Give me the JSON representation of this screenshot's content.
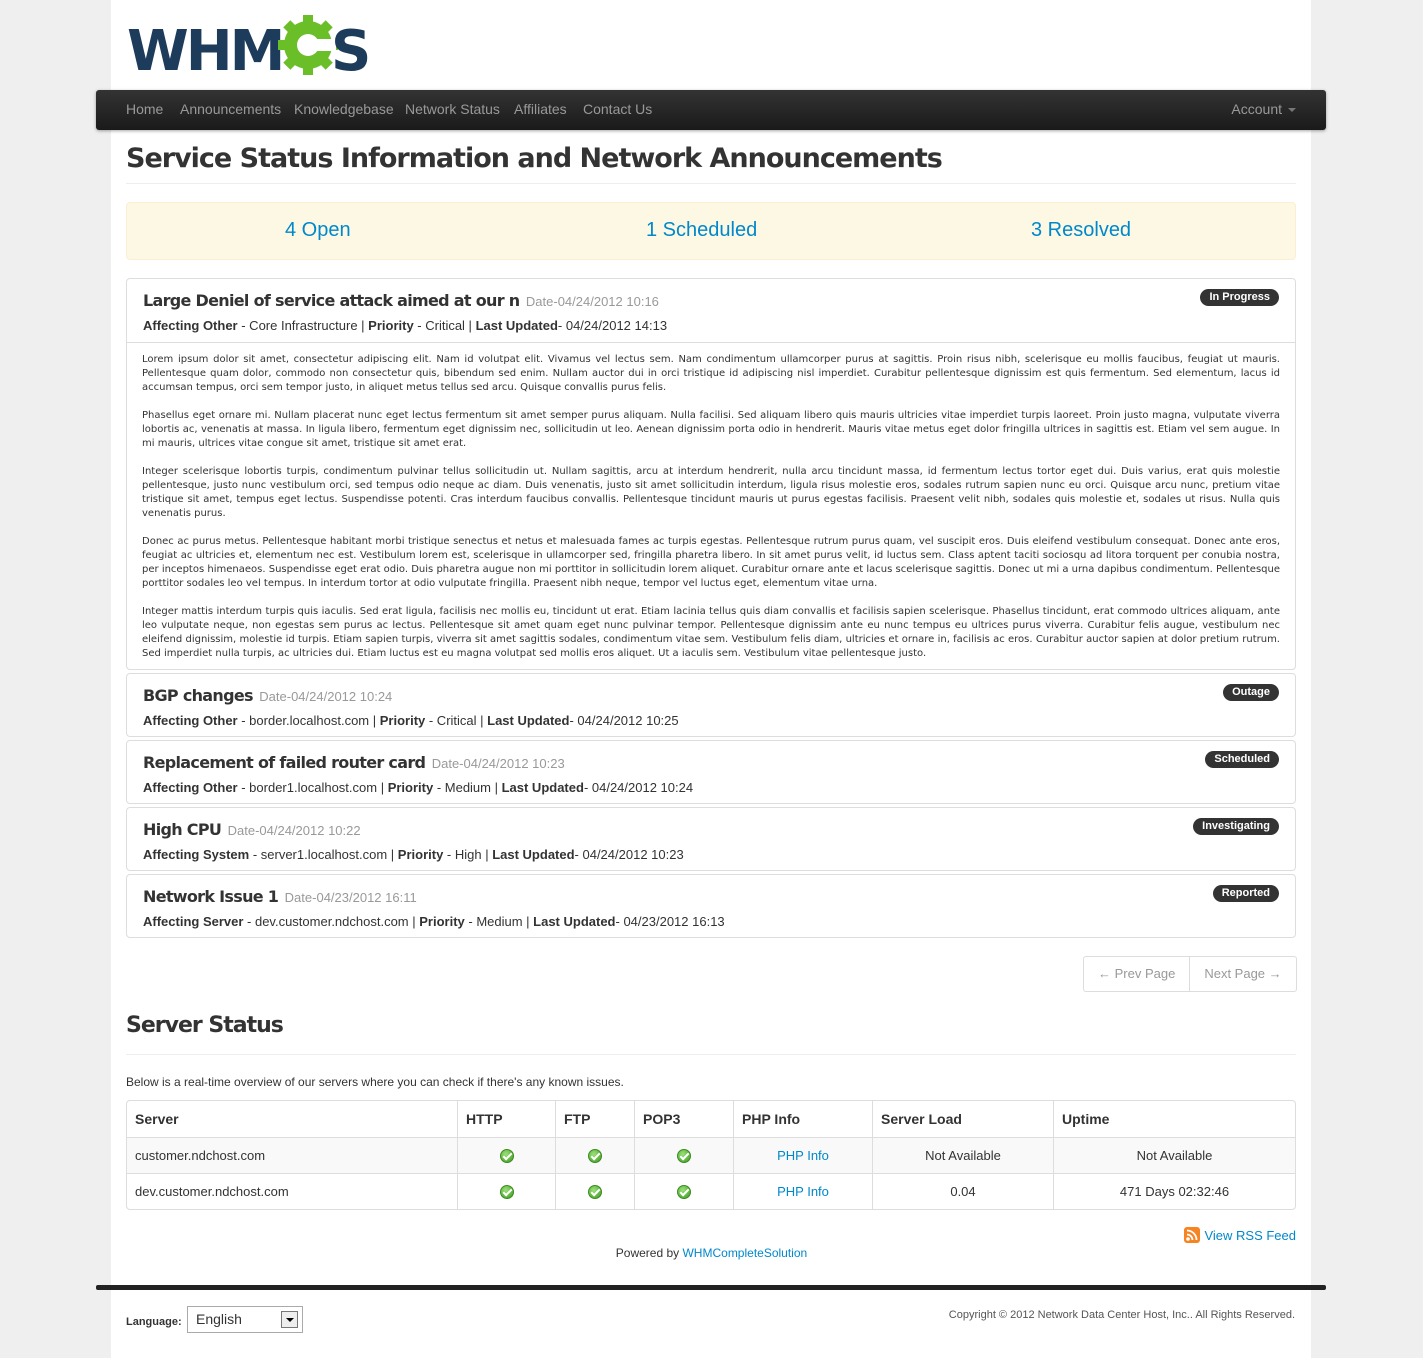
{
  "logo": {
    "text": "WHMCS",
    "accent": "#6abe28",
    "brand": "#1d3b5a"
  },
  "nav": {
    "items": [
      "Home",
      "Announcements",
      "Knowledgebase",
      "Network Status",
      "Affiliates",
      "Contact Us"
    ],
    "account": "Account"
  },
  "page_title": "Service Status Information and Network Announcements",
  "summary": {
    "open": "4 Open",
    "scheduled": "1 Scheduled",
    "resolved": "3 Resolved"
  },
  "issues": [
    {
      "title": "Large Deniel of service attack aimed at our n",
      "date": "Date-04/24/2012 10:16",
      "affecting_label": "Affecting Other",
      "affecting": " - Core Infrastructure | ",
      "priority_label": "Priority",
      "priority": " - Critical | ",
      "updated_label": "Last Updated",
      "updated": "- 04/24/2012 14:13",
      "status": "In Progress",
      "body": [
        "Lorem ipsum dolor sit amet, consectetur adipiscing elit. Nam id volutpat elit. Vivamus vel lectus sem. Nam condimentum ullamcorper purus at sagittis. Proin risus nibh, scelerisque eu mollis faucibus, feugiat ut mauris. Pellentesque quam dolor, commodo non consectetur quis, bibendum sed enim. Nullam auctor dui in orci tristique id adipiscing nisl imperdiet. Curabitur pellentesque dignissim est quis fermentum. Sed elementum, lacus id accumsan tempus, orci sem tempor justo, in aliquet metus tellus sed arcu. Quisque convallis purus felis.",
        "Phasellus eget ornare mi. Nullam placerat nunc eget lectus fermentum sit amet semper purus aliquam. Nulla facilisi. Sed aliquam libero quis mauris ultricies vitae imperdiet turpis laoreet. Proin justo magna, vulputate viverra lobortis ac, venenatis at massa. In ligula libero, fermentum eget dignissim nec, sollicitudin ut leo. Aenean dignissim porta odio in hendrerit. Mauris vitae metus eget dolor fringilla ultrices in sagittis est. Etiam vel sem augue. In mi mauris, ultrices vitae congue sit amet, tristique sit amet erat.",
        "Integer scelerisque lobortis turpis, condimentum pulvinar tellus sollicitudin ut. Nullam sagittis, arcu at interdum hendrerit, nulla arcu tincidunt massa, id fermentum lectus tortor eget dui. Duis varius, erat quis molestie pellentesque, justo nunc vestibulum orci, sed tempus odio neque ac diam. Duis venenatis, justo sit amet sollicitudin interdum, ligula risus molestie eros, sodales rutrum sapien nunc eu orci. Quisque arcu nunc, pretium vitae tristique sit amet, tempus eget lectus. Suspendisse potenti. Cras interdum faucibus convallis. Pellentesque tincidunt mauris ut purus egestas facilisis. Praesent velit nibh, sodales quis molestie et, sodales ut risus. Nulla quis venenatis purus.",
        "Donec ac purus metus. Pellentesque habitant morbi tristique senectus et netus et malesuada fames ac turpis egestas. Pellentesque rutrum purus quam, vel suscipit eros. Duis eleifend vestibulum consequat. Donec ante eros, feugiat ac ultricies et, elementum nec est. Vestibulum lorem est, scelerisque in ullamcorper sed, fringilla pharetra libero. In sit amet purus velit, id luctus sem. Class aptent taciti sociosqu ad litora torquent per conubia nostra, per inceptos himenaeos. Suspendisse eget erat odio. Duis pharetra augue non mi porttitor in sollicitudin lorem aliquet. Curabitur ornare ante et lacus scelerisque sagittis. Donec ut mi a urna dapibus condimentum. Pellentesque porttitor sodales leo vel tempus. In interdum tortor at odio vulputate fringilla. Praesent nibh neque, tempor vel luctus eget, elementum vitae urna.",
        "Integer mattis interdum turpis quis iaculis. Sed erat ligula, facilisis nec mollis eu, tincidunt ut erat. Etiam lacinia tellus quis diam convallis et facilisis sapien scelerisque. Phasellus tincidunt, erat commodo ultrices aliquam, ante leo vulputate neque, non egestas sem purus ac lectus. Pellentesque sit amet quam eget nunc pulvinar tempor. Pellentesque dignissim ante eu nunc tempus eu ultrices purus viverra. Curabitur felis augue, vestibulum nec eleifend dignissim, molestie id turpis. Etiam sapien turpis, viverra sit amet sagittis sodales, condimentum vitae sem. Vestibulum felis diam, ultricies et ornare in, facilisis ac eros. Curabitur auctor sapien at dolor pretium rutrum. Sed imperdiet nulla turpis, ac ultricies dui. Etiam luctus est eu magna volutpat sed mollis eros aliquet. Ut a iaculis sem. Vestibulum vitae pellentesque justo."
      ]
    },
    {
      "title": "BGP changes",
      "date": "Date-04/24/2012 10:24",
      "affecting_label": "Affecting Other",
      "affecting": " - border.localhost.com | ",
      "priority_label": "Priority",
      "priority": " - Critical | ",
      "updated_label": "Last Updated",
      "updated": "- 04/24/2012 10:25",
      "status": "Outage"
    },
    {
      "title": "Replacement of failed router card",
      "date": "Date-04/24/2012 10:23",
      "affecting_label": "Affecting Other",
      "affecting": " - border1.localhost.com | ",
      "priority_label": "Priority",
      "priority": " - Medium | ",
      "updated_label": "Last Updated",
      "updated": "- 04/24/2012 10:24",
      "status": "Scheduled"
    },
    {
      "title": "High CPU",
      "date": "Date-04/24/2012 10:22",
      "affecting_label": "Affecting System",
      "affecting": " - server1.localhost.com | ",
      "priority_label": "Priority",
      "priority": " - High | ",
      "updated_label": "Last Updated",
      "updated": "- 04/24/2012 10:23",
      "status": "Investigating"
    },
    {
      "title": "Network Issue 1",
      "date": "Date-04/23/2012 16:11",
      "affecting_label": "Affecting Server",
      "affecting": " - dev.customer.ndchost.com | ",
      "priority_label": "Priority",
      "priority": " - Medium | ",
      "updated_label": "Last Updated",
      "updated": "- 04/23/2012 16:13",
      "status": "Reported"
    }
  ],
  "pager": {
    "prev": "← Prev Page",
    "next": "Next Page →"
  },
  "server_status": {
    "title": "Server Status",
    "intro": "Below is a real-time overview of our servers where you can check if there's any known issues.",
    "columns": [
      "Server",
      "HTTP",
      "FTP",
      "POP3",
      "PHP Info",
      "Server Load",
      "Uptime"
    ],
    "rows": [
      {
        "server": "customer.ndchost.com",
        "http": "ok",
        "ftp": "ok",
        "pop3": "ok",
        "php": "PHP Info",
        "load": "Not Available",
        "uptime": "Not Available"
      },
      {
        "server": "dev.customer.ndchost.com",
        "http": "ok",
        "ftp": "ok",
        "pop3": "ok",
        "php": "PHP Info",
        "load": "0.04",
        "uptime": "471 Days 02:32:46"
      }
    ]
  },
  "rss": "View RSS Feed",
  "powered": {
    "prefix": "Powered by ",
    "link": "WHMCompleteSolution"
  },
  "footer": {
    "language_label": "Language:",
    "language_value": "English",
    "copyright": "Copyright © 2012 Network Data Center Host, Inc.. All Rights Reserved."
  }
}
